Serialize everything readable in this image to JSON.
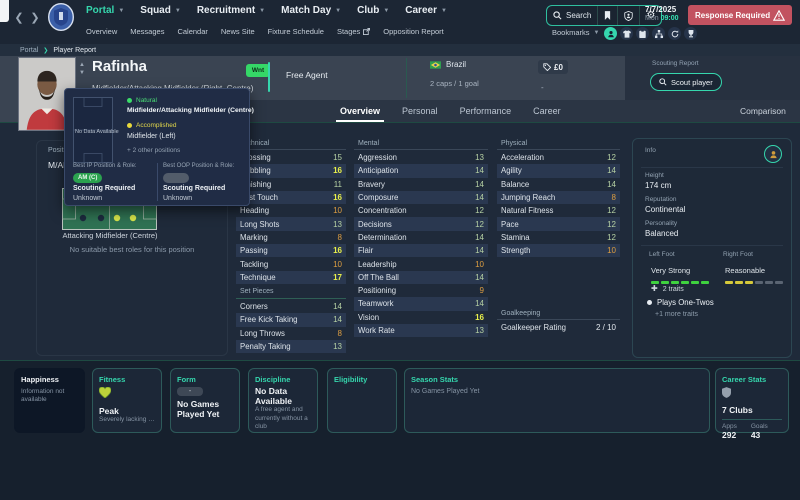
{
  "colors": {
    "accent": "#35d6ad",
    "alert": "#c25260",
    "attr_high": "#e9f04b",
    "attr_mid": "#b7d2a4",
    "attr_low": "#dd9e42",
    "natural": "#3bdc69",
    "accomplished": "#e8d93c",
    "time": "#35e0b2",
    "wanted_green": "#35d867",
    "badge_green": "#2ba24f"
  },
  "topbar": {
    "main_menu": [
      "Portal",
      "Squad",
      "Recruitment",
      "Match Day",
      "Club",
      "Career"
    ],
    "active_menu": "Portal",
    "sub_menu": [
      "Overview",
      "Messages",
      "Calendar",
      "News Site",
      "Fixture Schedule",
      "Stages",
      "Opposition Report"
    ],
    "search_label": "Search",
    "date": {
      "date": "7/7/2025",
      "day": "Mon",
      "time": "09:00"
    },
    "alert": "Response Required",
    "bookmarks_label": "Bookmarks"
  },
  "breadcrumb": {
    "root": "Portal",
    "sep": "❯",
    "current": "Player Report"
  },
  "player": {
    "name": "Rafinha",
    "position_summary": "Midfielder/Attacking Midfielder (Right, Centre)",
    "status_badge": "Wnt",
    "contract_status": "Free Agent",
    "nation": "Brazil",
    "caps": "2 caps / 1 goal",
    "value": "£0",
    "value_sub": "-",
    "scouting_report_label": "Scouting Report",
    "scout_button": "Scout player"
  },
  "tabs": {
    "items": [
      "Overview",
      "Personal",
      "Performance",
      "Career"
    ],
    "active": "Overview",
    "comparison": "Comparison"
  },
  "positions_panel": {
    "title": "Positions",
    "positions": "M/AM (RC)",
    "pitch_caption": "Attacking Midfielder (Centre)",
    "note": "No suitable best roles for this position"
  },
  "tooltip": {
    "no_data": "No Data Available",
    "natural_label": "Natural",
    "natural_positions": "Midfielder/Attacking Midfielder (Centre)",
    "accomplished_label": "Accomplished",
    "accomplished_positions": "Midfielder (Left)",
    "more": "+ 2 other positions",
    "best_ip_label": "Best IP Position & Role:",
    "best_ip_badge": "AM (C)",
    "best_oop_label": "Best OOP Position & Role:",
    "scouting_required": "Scouting Required",
    "unknown": "Unknown"
  },
  "attributes": {
    "technical": {
      "title": "Technical",
      "rows": [
        {
          "label": "Crossing",
          "value": 15
        },
        {
          "label": "Dribbling",
          "value": 16
        },
        {
          "label": "Finishing",
          "value": 11
        },
        {
          "label": "First Touch",
          "value": 16
        },
        {
          "label": "Heading",
          "value": 10
        },
        {
          "label": "Long Shots",
          "value": 13
        },
        {
          "label": "Marking",
          "value": 8
        },
        {
          "label": "Passing",
          "value": 16
        },
        {
          "label": "Tackling",
          "value": 10
        },
        {
          "label": "Technique",
          "value": 17
        }
      ]
    },
    "set_pieces": {
      "title": "Set Pieces",
      "rows": [
        {
          "label": "Corners",
          "value": 14
        },
        {
          "label": "Free Kick Taking",
          "value": 14
        },
        {
          "label": "Long Throws",
          "value": 8
        },
        {
          "label": "Penalty Taking",
          "value": 13
        }
      ]
    },
    "mental": {
      "title": "Mental",
      "rows": [
        {
          "label": "Aggression",
          "value": 13
        },
        {
          "label": "Anticipation",
          "value": 14
        },
        {
          "label": "Bravery",
          "value": 14
        },
        {
          "label": "Composure",
          "value": 14
        },
        {
          "label": "Concentration",
          "value": 12
        },
        {
          "label": "Decisions",
          "value": 12
        },
        {
          "label": "Determination",
          "value": 14
        },
        {
          "label": "Flair",
          "value": 14
        },
        {
          "label": "Leadership",
          "value": 10
        },
        {
          "label": "Off The Ball",
          "value": 14
        },
        {
          "label": "Positioning",
          "value": 9
        },
        {
          "label": "Teamwork",
          "value": 14
        },
        {
          "label": "Vision",
          "value": 16
        },
        {
          "label": "Work Rate",
          "value": 13
        }
      ]
    },
    "physical": {
      "title": "Physical",
      "rows": [
        {
          "label": "Acceleration",
          "value": 12
        },
        {
          "label": "Agility",
          "value": 14
        },
        {
          "label": "Balance",
          "value": 14
        },
        {
          "label": "Jumping Reach",
          "value": 8
        },
        {
          "label": "Natural Fitness",
          "value": 12
        },
        {
          "label": "Pace",
          "value": 12
        },
        {
          "label": "Stamina",
          "value": 12
        },
        {
          "label": "Strength",
          "value": 10
        }
      ]
    },
    "goalkeeping": {
      "title": "Goalkeeping",
      "rows": [
        {
          "label": "Goalkeeper Rating",
          "value": "2 / 10"
        }
      ]
    }
  },
  "info_panel": {
    "title": "Info",
    "height_label": "Height",
    "height": "174 cm",
    "reputation_label": "Reputation",
    "reputation": "Continental",
    "personality_label": "Personality",
    "personality": "Balanced",
    "left_foot_label": "Left Foot",
    "left_foot": "Very Strong",
    "right_foot_label": "Right Foot",
    "right_foot": "Reasonable",
    "traits_count": "2 traits",
    "trait_1": "Plays One-Twos",
    "more_traits": "+1 more traits"
  },
  "cards": {
    "happiness": {
      "title": "Happiness",
      "text": "Information not available"
    },
    "fitness": {
      "title": "Fitness",
      "status": "Peak",
      "note": "Severely lacking in ..."
    },
    "form": {
      "title": "Form",
      "pill": "-",
      "text": "No Games Played Yet"
    },
    "discipline": {
      "title": "Discipline",
      "headline": "No Data Available",
      "text": "A free agent and currently without a club"
    },
    "eligibility": {
      "title": "Eligibility"
    },
    "season": {
      "title": "Season Stats",
      "text": "No Games Played Yet"
    },
    "career": {
      "title": "Career Stats",
      "clubs": "7 Clubs",
      "apps_label": "Apps",
      "apps": "292",
      "goals_label": "Goals",
      "goals": "43"
    }
  }
}
